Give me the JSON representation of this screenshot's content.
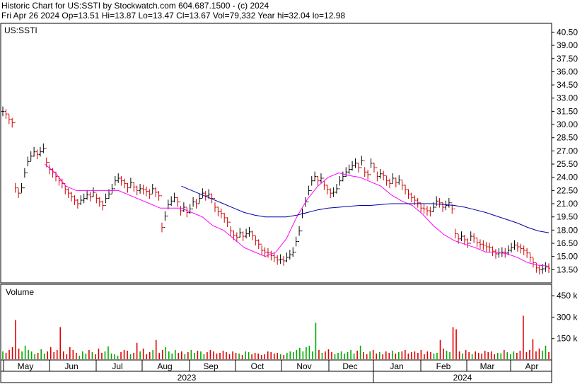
{
  "header": {
    "line1": "Historic Chart for US:SSTI by Stockwatch.com 604.687.1500 - (c) 2024",
    "line2": "Fri Apr 26 2024  Op=13.51  Hi=13.87  Lo=13.47  Cl=13.67  Vol=79,332  Year hi=32.04  lo=12.98"
  },
  "colors": {
    "up_candle": "#000000",
    "down_candle": "#cc0000",
    "ma_short": "#ff00ff",
    "ma_long": "#0000aa",
    "volume_up": "#00aa00",
    "volume_down": "#dd0000"
  },
  "chart_data": [
    {
      "type": "line",
      "title": "US:SSTI",
      "price_axis_ticks": [
        "40.50",
        "39.00",
        "37.50",
        "36.00",
        "34.50",
        "33.00",
        "31.50",
        "30.00",
        "28.50",
        "27.00",
        "25.50",
        "24.00",
        "22.50",
        "21.00",
        "19.50",
        "18.00",
        "16.50",
        "15.00",
        "13.50"
      ],
      "ylim": [
        12.0,
        41.5
      ],
      "x_month_labels": [
        "May",
        "Jun",
        "Jul",
        "Aug",
        "Sep",
        "Oct",
        "Nov",
        "Dec",
        "Jan",
        "Feb",
        "Mar",
        "Apr"
      ],
      "year_labels": [
        "2023",
        "2024"
      ],
      "series": [
        {
          "x": [
            "May-01",
            "May-08",
            "May-15",
            "May-22",
            "May-29",
            "Jun-05",
            "Jun-12",
            "Jun-19",
            "Jun-26",
            "Jul-03",
            "Jul-10",
            "Jul-17",
            "Jul-24",
            "Jul-31",
            "Aug-07",
            "Aug-14",
            "Aug-21",
            "Aug-28",
            "Sep-04",
            "Sep-11",
            "Sep-18",
            "Sep-25",
            "Oct-02",
            "Oct-09",
            "Oct-16",
            "Oct-23",
            "Oct-30",
            "Nov-06",
            "Nov-13",
            "Nov-20",
            "Nov-27",
            "Dec-04",
            "Dec-11",
            "Dec-18",
            "Dec-25",
            "Jan-01",
            "Jan-08",
            "Jan-15",
            "Jan-22",
            "Jan-29",
            "Feb-05",
            "Feb-12",
            "Feb-19",
            "Feb-26",
            "Mar-04",
            "Mar-11",
            "Mar-18",
            "Mar-25",
            "Apr-01",
            "Apr-08",
            "Apr-15",
            "Apr-22",
            "Apr-26"
          ],
          "values": [
            31.0,
            22.5,
            25.5,
            27.0,
            24.0,
            22.0,
            21.5,
            22.5,
            21.0,
            23.5,
            22.5,
            22.0,
            21.5,
            19.5,
            21.0,
            20.5,
            21.5,
            21.0,
            19.5,
            18.0,
            17.0,
            17.5,
            16.0,
            15.0,
            14.5,
            15.0,
            18.5,
            23.5,
            22.0,
            23.5,
            24.5,
            25.5,
            24.0,
            23.5,
            23.0,
            22.5,
            21.0,
            20.5,
            20.0,
            21.0,
            17.5,
            16.5,
            16.0,
            16.5,
            15.5,
            15.0,
            15.5,
            16.0,
            15.0,
            14.0,
            13.5,
            13.6,
            13.67
          ]
        },
        {
          "values": [
            null,
            null,
            null,
            null,
            25.5,
            24.5,
            23.0,
            22.5,
            22.5,
            22.5,
            22.5,
            22.5,
            22.0,
            21.5,
            21.0,
            20.5,
            20.5,
            20.5,
            20.0,
            19.5,
            18.5,
            18.0,
            17.0,
            16.0,
            15.5,
            15.0,
            15.5,
            17.0,
            19.5,
            21.5,
            23.0,
            24.0,
            24.5,
            24.2,
            24.0,
            23.5,
            23.0,
            22.0,
            21.3,
            20.8,
            19.8,
            18.5,
            17.5,
            16.8,
            16.4,
            16.0,
            15.5,
            15.5,
            15.3,
            14.9,
            14.3,
            14.0,
            13.9
          ]
        },
        {
          "values": [
            null,
            null,
            null,
            null,
            null,
            null,
            null,
            null,
            null,
            null,
            null,
            null,
            null,
            null,
            null,
            null,
            null,
            23.0,
            22.5,
            22.0,
            21.5,
            21.0,
            20.5,
            20.0,
            19.7,
            19.5,
            19.5,
            19.5,
            19.7,
            20.0,
            20.3,
            20.5,
            20.6,
            20.7,
            20.8,
            20.8,
            20.9,
            21.0,
            21.0,
            21.0,
            21.0,
            21.0,
            20.9,
            20.8,
            20.6,
            20.3,
            20.0,
            19.6,
            19.2,
            18.8,
            18.3,
            17.9,
            17.7
          ]
        }
      ],
      "candles": [
        31.5,
        31.2,
        30.6,
        30.2,
        22.8,
        22.2,
        22.8,
        24.5,
        25.8,
        26.4,
        26.9,
        26.6,
        26.9,
        27.3,
        25.7,
        24.9,
        24.5,
        24.1,
        23.6,
        23.3,
        22.6,
        22.2,
        21.8,
        21.4,
        21.0,
        21.4,
        21.6,
        22.0,
        21.8,
        22.3,
        21.6,
        21.2,
        20.8,
        21.6,
        22.1,
        22.7,
        23.6,
        23.9,
        23.6,
        23.3,
        22.8,
        23.4,
        22.9,
        22.5,
        22.7,
        22.6,
        22.4,
        22.1,
        22.7,
        22.3,
        21.9,
        18.3,
        19.6,
        20.9,
        21.3,
        21.7,
        21.2,
        20.2,
        20.6,
        20.0,
        20.4,
        21.2,
        21.0,
        21.6,
        22.2,
        21.9,
        22.1,
        21.6,
        20.6,
        20.1,
        19.9,
        19.4,
        18.9,
        17.9,
        17.4,
        17.2,
        17.7,
        17.3,
        17.6,
        17.8,
        17.4,
        16.8,
        16.4,
        15.7,
        15.5,
        15.4,
        15.1,
        14.9,
        14.6,
        14.7,
        14.5,
        14.9,
        15.2,
        15.5,
        16.7,
        17.9,
        19.9,
        21.2,
        22.5,
        23.6,
        24.1,
        23.6,
        23.9,
        23.1,
        22.6,
        22.2,
        22.3,
        22.7,
        23.6,
        24.1,
        24.6,
        24.9,
        25.3,
        25.6,
        25.1,
        25.9,
        24.6,
        24.3,
        25.6,
        25.1,
        24.1,
        24.4,
        24.2,
        23.6,
        23.3,
        23.9,
        23.4,
        23.7,
        23.1,
        22.6,
        22.1,
        21.7,
        21.4,
        21.1,
        20.5,
        20.4,
        20.2,
        20.1,
        20.6,
        21.3,
        21.1,
        20.6,
        20.8,
        21.1,
        20.4,
        17.6,
        17.0,
        17.3,
        16.9,
        16.5,
        17.3,
        17.1,
        16.6,
        16.4,
        16.3,
        16.1,
        16.0,
        15.6,
        15.3,
        15.4,
        15.5,
        15.4,
        15.7,
        16.0,
        16.3,
        16.1,
        15.9,
        15.7,
        15.4,
        14.9,
        14.3,
        13.7,
        13.5,
        13.6,
        13.8,
        13.67
      ],
      "volume_panel": {
        "label": "Volume",
        "ticks": [
          "450 k",
          "300 k",
          "150 k"
        ],
        "ylim": [
          0,
          530
        ],
        "values": [
          60,
          50,
          70,
          90,
          280,
          80,
          60,
          100,
          70,
          60,
          40,
          50,
          75,
          45,
          60,
          90,
          55,
          70,
          230,
          60,
          40,
          90,
          70,
          50,
          30,
          60,
          45,
          70,
          55,
          40,
          80,
          50,
          60,
          95,
          45,
          40,
          30,
          55,
          70,
          65,
          40,
          50,
          120,
          60,
          80,
          40,
          55,
          70,
          140,
          50,
          70,
          90,
          60,
          45,
          70,
          50,
          60,
          40,
          55,
          70,
          50,
          65,
          60,
          40,
          55,
          70,
          60,
          45,
          50,
          65,
          55,
          40,
          60,
          50,
          45,
          35,
          60,
          55,
          40,
          50,
          45,
          35,
          40,
          60,
          55,
          45,
          50,
          40,
          35,
          50,
          60,
          55,
          70,
          85,
          60,
          90,
          100,
          60,
          260,
          70,
          50,
          60,
          75,
          55,
          40,
          50,
          60,
          45,
          55,
          70,
          45,
          65,
          100,
          55,
          40,
          60,
          70,
          45,
          55,
          40,
          60,
          50,
          65,
          45,
          55,
          60,
          70,
          45,
          55,
          60,
          50,
          70,
          40,
          60,
          55,
          45,
          50,
          140,
          80,
          65,
          55,
          230,
          215,
          60,
          45,
          70,
          55,
          40,
          60,
          50,
          45,
          65,
          55,
          60,
          40,
          50,
          45,
          70,
          55,
          40,
          60,
          50,
          65,
          310,
          55,
          70,
          145,
          60,
          80,
          65,
          100,
          55
        ],
        "colors": "mixed"
      }
    }
  ]
}
